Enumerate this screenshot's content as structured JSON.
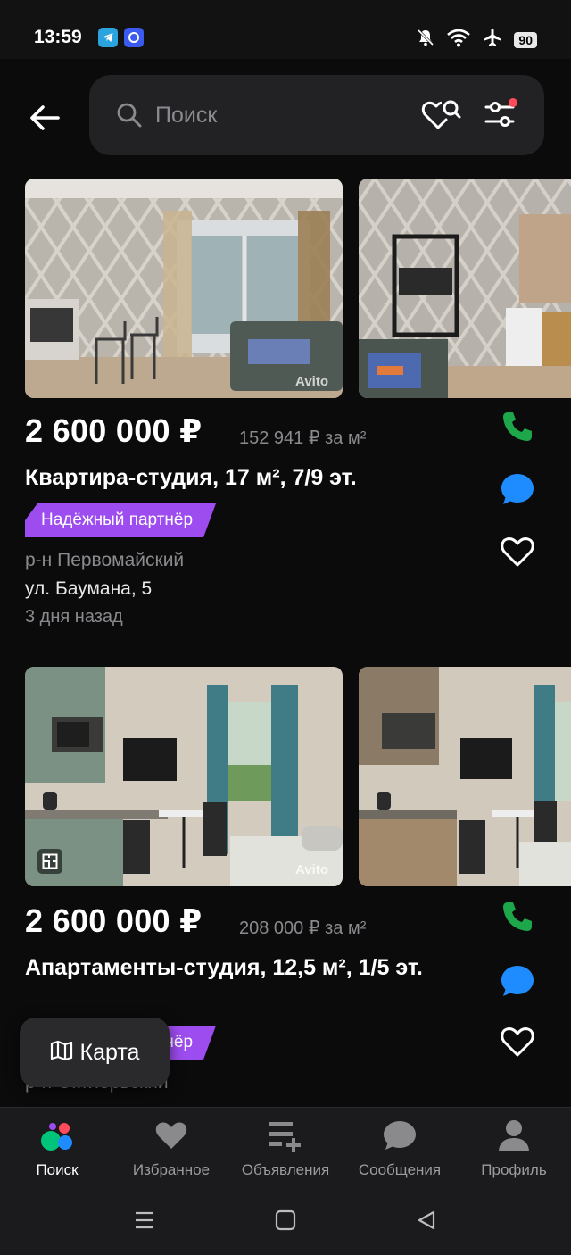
{
  "status_bar": {
    "time": "13:59",
    "battery": "90"
  },
  "search": {
    "placeholder": "Поиск"
  },
  "listings": [
    {
      "price": "2 600 000 ₽",
      "price_per_m2": "152 941 ₽ за м²",
      "title": "Квартира-студия, 17 м², 7/9 эт.",
      "badge": "Надёжный партнёр",
      "district": "р-н Первомайский",
      "street": "ул. Баумана, 5",
      "posted": "3 дня назад",
      "watermark": "Avito"
    },
    {
      "price": "2 600 000 ₽",
      "price_per_m2": "208 000 ₽ за м²",
      "title": "Апартаменты-студия, 12,5 м², 1/5 эт.",
      "badge": "Надёжный партнёр",
      "district": "р-н Октябрьский",
      "watermark": "Avito"
    }
  ],
  "map_button": {
    "label": "Карта"
  },
  "bottom_nav": [
    {
      "label": "Поиск",
      "icon": "search-logo-icon",
      "active": true
    },
    {
      "label": "Избранное",
      "icon": "heart-icon"
    },
    {
      "label": "Объявления",
      "icon": "add-list-icon"
    },
    {
      "label": "Сообщения",
      "icon": "chat-icon"
    },
    {
      "label": "Профиль",
      "icon": "person-icon"
    }
  ],
  "colors": {
    "accent_purple": "#9d4cf0",
    "call_green": "#1ea64a",
    "message_blue": "#1e8cff",
    "background": "#0b0b0b"
  }
}
